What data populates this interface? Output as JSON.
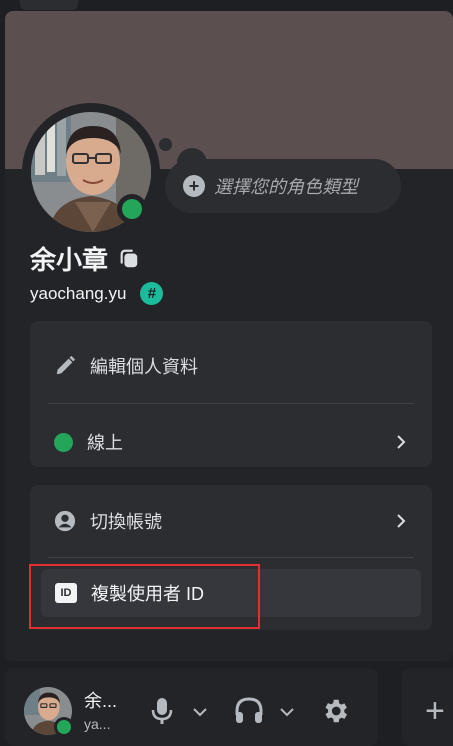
{
  "profile": {
    "role_prompt": "選擇您的角色類型",
    "display_name": "余小章",
    "username": "yaochang.yu",
    "username_badge": "#",
    "status_color": "#23a55a",
    "banner_color": "#5b4f4f"
  },
  "menu": {
    "edit_profile": "編輯個人資料",
    "status": "線上",
    "switch_account": "切換帳號",
    "copy_user_id": "複製使用者 ID",
    "id_icon_text": "ID"
  },
  "user_panel": {
    "name": "余...",
    "sub": "ya..."
  },
  "icons": {
    "edit": "pencil-icon",
    "status": "online-dot-icon",
    "switch": "account-icon",
    "copy_id": "id-card-icon",
    "mic": "microphone-icon",
    "headphones": "headphones-icon",
    "settings": "gear-icon"
  }
}
